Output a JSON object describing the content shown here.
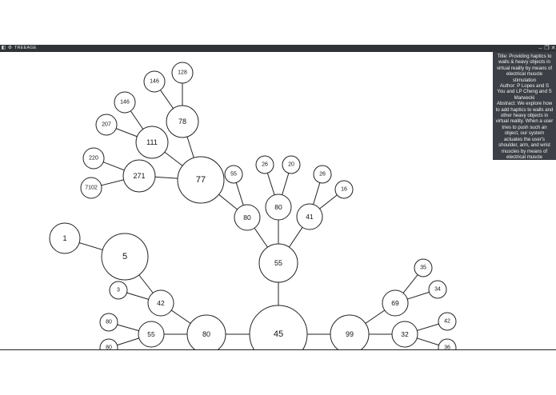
{
  "app": {
    "window_title": "TREEAGE",
    "app_icon": "n-logo-icon",
    "settings_icon": "gear-icon"
  },
  "window_controls": {
    "minimize": "–",
    "restore": "❐",
    "close": "✕"
  },
  "info_panel": {
    "title_line": "Title: Providing haptics to walls & heavy objects in virtual reality by means of electrical muscle stimulation",
    "author_line": "Author: P Lopes and S You and LP Cheng and S Marwecki",
    "abstract_line": "Abstract: We explore how to add haptics to walls and other heavy objects in virtual reality. When a user tries to push such an object, our system actuates the user's shoulder, arm, and wrist muscles by means of electrical muscle stimulation, creating a counter force that pulls the ..."
  },
  "tree": {
    "nodes": [
      {
        "id": "n45",
        "label": "45"
      },
      {
        "id": "n55c",
        "label": "55"
      },
      {
        "id": "n80a",
        "label": "80"
      },
      {
        "id": "n80b",
        "label": "80"
      },
      {
        "id": "n41",
        "label": "41"
      },
      {
        "id": "n26a",
        "label": "26"
      },
      {
        "id": "n20",
        "label": "20"
      },
      {
        "id": "n26b",
        "label": "26"
      },
      {
        "id": "n16",
        "label": "16"
      },
      {
        "id": "n77",
        "label": "77"
      },
      {
        "id": "n55s",
        "label": "55"
      },
      {
        "id": "n78",
        "label": "78"
      },
      {
        "id": "n146a",
        "label": "146"
      },
      {
        "id": "n128",
        "label": "128"
      },
      {
        "id": "n271",
        "label": "271"
      },
      {
        "id": "n220",
        "label": "220"
      },
      {
        "id": "n7102",
        "label": "7102"
      },
      {
        "id": "n111",
        "label": "111"
      },
      {
        "id": "n146b",
        "label": "146"
      },
      {
        "id": "n207",
        "label": "207"
      },
      {
        "id": "n80l",
        "label": "80"
      },
      {
        "id": "n42l",
        "label": "42"
      },
      {
        "id": "n5",
        "label": "5"
      },
      {
        "id": "n1",
        "label": "1"
      },
      {
        "id": "n3",
        "label": "3"
      },
      {
        "id": "n55l",
        "label": "55"
      },
      {
        "id": "n80p",
        "label": "80"
      },
      {
        "id": "n80q",
        "label": "80"
      },
      {
        "id": "n99",
        "label": "99"
      },
      {
        "id": "n69",
        "label": "69"
      },
      {
        "id": "n35",
        "label": "35"
      },
      {
        "id": "n34",
        "label": "34"
      },
      {
        "id": "n32",
        "label": "32"
      },
      {
        "id": "n42r",
        "label": "42"
      },
      {
        "id": "n36",
        "label": "36"
      }
    ]
  }
}
